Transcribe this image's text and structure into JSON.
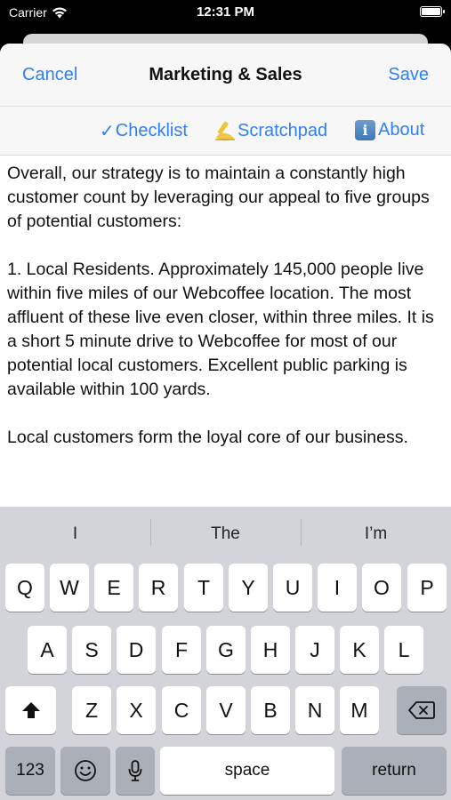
{
  "status_bar": {
    "carrier": "Carrier",
    "time": "12:31 PM"
  },
  "nav": {
    "cancel": "Cancel",
    "title": "Marketing & Sales",
    "save": "Save"
  },
  "toolbar": {
    "checklist_icon": "✓",
    "checklist": "Checklist",
    "scratchpad": "Scratchpad",
    "about": "About"
  },
  "editor": {
    "text": "Overall, our strategy is to maintain a constantly high customer count by leveraging our appeal to five groups of potential customers:\n\n1. Local Residents. Approximately 145,000 people live within five miles of our Webcoffee location. The most affluent of these live even closer, within three miles. It is a short 5 minute drive to Webcoffee for most of our potential local customers. Excellent public parking is available within 100 yards.\n\nLocal customers form the loyal core of our business."
  },
  "keyboard": {
    "suggestions": [
      "I",
      "The",
      "I’m"
    ],
    "row1": [
      "Q",
      "W",
      "E",
      "R",
      "T",
      "Y",
      "U",
      "I",
      "O",
      "P"
    ],
    "row2": [
      "A",
      "S",
      "D",
      "F",
      "G",
      "H",
      "J",
      "K",
      "L"
    ],
    "row3": [
      "Z",
      "X",
      "C",
      "V",
      "B",
      "N",
      "M"
    ],
    "numbers": "123",
    "space": "space",
    "return": "return",
    "icons": {
      "shift": "shift-icon",
      "delete": "delete-icon",
      "emoji": "emoji-icon",
      "mic": "microphone-icon"
    }
  },
  "colors": {
    "accent": "#2f7ff6",
    "keyboard_bg": "#d2d4da",
    "key_dark": "#abafb8"
  }
}
